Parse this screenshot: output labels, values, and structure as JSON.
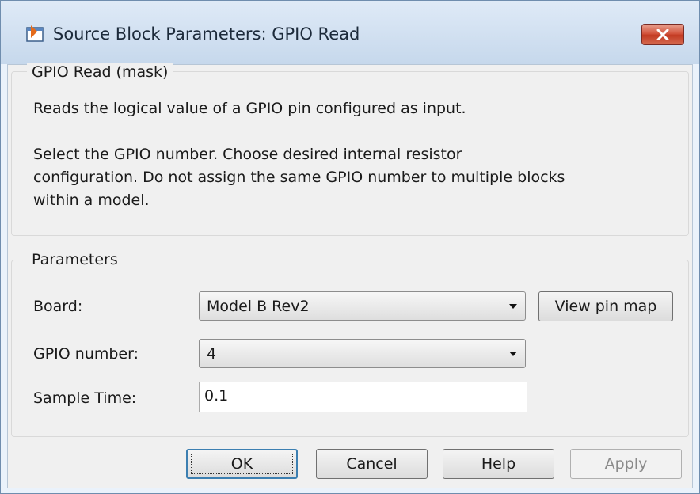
{
  "window": {
    "title": "Source Block Parameters: GPIO Read",
    "close_icon": "close-icon",
    "colors": {
      "titlebar": "#c6d8ec",
      "close_button": "#c23a22",
      "frame": "#6f8dae"
    }
  },
  "mask_group": {
    "legend": "GPIO Read (mask)",
    "description_line_1": "Reads the logical value of a GPIO pin configured as input.",
    "description_line_2": "Select the GPIO number. Choose desired internal resistor",
    "description_line_3": "configuration. Do not assign the same GPIO number to multiple blocks",
    "description_line_4": "within a model."
  },
  "parameters_group": {
    "legend": "Parameters",
    "board_label": "Board:",
    "board_value": "Model B Rev2",
    "view_pin_map_label": "View pin map",
    "gpio_label": "GPIO number:",
    "gpio_value": "4",
    "sample_time_label": "Sample Time:",
    "sample_time_value": "0.1"
  },
  "buttons": {
    "ok": "OK",
    "cancel": "Cancel",
    "help": "Help",
    "apply": "Apply"
  }
}
